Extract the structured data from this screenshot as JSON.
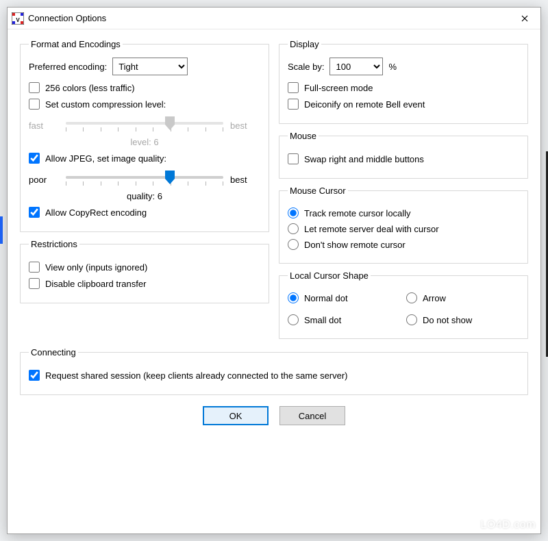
{
  "window": {
    "title": "Connection Options"
  },
  "format": {
    "legend": "Format and Encodings",
    "preferred_label": "Preferred encoding:",
    "encoding_selected": "Tight",
    "colors256": "256 colors (less traffic)",
    "set_compression": "Set custom compression level:",
    "compression_slider": {
      "left": "fast",
      "right": "best",
      "caption": "level: 6",
      "value": 6,
      "min": 0,
      "max": 9
    },
    "allow_jpeg": "Allow JPEG, set image quality:",
    "quality_slider": {
      "left": "poor",
      "right": "best",
      "caption": "quality: 6",
      "value": 6,
      "min": 0,
      "max": 9
    },
    "allow_copyrect": "Allow CopyRect encoding"
  },
  "restrictions": {
    "legend": "Restrictions",
    "view_only": "View only (inputs ignored)",
    "disable_clipboard": "Disable clipboard transfer"
  },
  "display": {
    "legend": "Display",
    "scale_label": "Scale by:",
    "scale_selected": "100",
    "scale_suffix": "%",
    "fullscreen": "Full-screen mode",
    "deiconify": "Deiconify on remote Bell event"
  },
  "mouse": {
    "legend": "Mouse",
    "swap": "Swap right and middle buttons"
  },
  "mouse_cursor": {
    "legend": "Mouse Cursor",
    "track": "Track remote cursor locally",
    "remote": "Let remote server deal with cursor",
    "hide": "Don't show remote cursor"
  },
  "local_cursor": {
    "legend": "Local Cursor Shape",
    "normal": "Normal dot",
    "arrow": "Arrow",
    "small": "Small dot",
    "hide": "Do not show"
  },
  "connecting": {
    "legend": "Connecting",
    "shared": "Request shared session (keep clients already connected to the same server)"
  },
  "buttons": {
    "ok": "OK",
    "cancel": "Cancel"
  },
  "watermark": "LO4D.com"
}
